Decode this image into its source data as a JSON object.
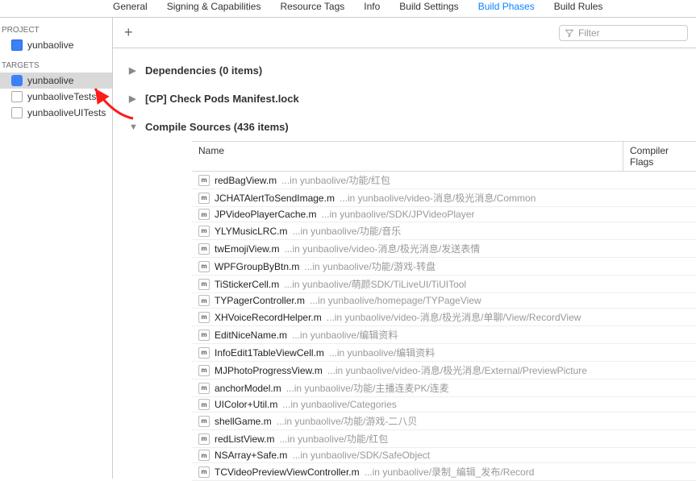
{
  "tabs": {
    "general": "General",
    "signing": "Signing & Capabilities",
    "resource": "Resource Tags",
    "info": "Info",
    "buildSettings": "Build Settings",
    "buildPhases": "Build Phases",
    "buildRules": "Build Rules"
  },
  "sidebar": {
    "projectLabel": "PROJECT",
    "project": "yunbaolive",
    "targetsLabel": "TARGETS",
    "targets": [
      "yunbaolive",
      "yunbaoliveTests",
      "yunbaoliveUITests"
    ]
  },
  "header": {
    "filterPlaceholder": "Filter"
  },
  "phases": {
    "dependencies": {
      "label": "Dependencies (0 items)"
    },
    "checkPods": {
      "label": "[CP] Check Pods Manifest.lock"
    },
    "compileSources": {
      "label": "Compile Sources (436 items)"
    }
  },
  "table": {
    "nameHeader": "Name",
    "flagsHeader": "Compiler Flags"
  },
  "files": [
    {
      "name": "redBagView.m",
      "path": "...in yunbaolive/功能/红包"
    },
    {
      "name": "JCHATAlertToSendImage.m",
      "path": "...in yunbaolive/video-消息/极光消息/Common"
    },
    {
      "name": "JPVideoPlayerCache.m",
      "path": "...in yunbaolive/SDK/JPVideoPlayer"
    },
    {
      "name": "YLYMusicLRC.m",
      "path": "...in yunbaolive/功能/音乐"
    },
    {
      "name": "twEmojiView.m",
      "path": "...in yunbaolive/video-消息/极光消息/发送表情"
    },
    {
      "name": "WPFGroupByBtn.m",
      "path": "...in yunbaolive/功能/游戏-转盘"
    },
    {
      "name": "TiStickerCell.m",
      "path": "...in yunbaolive/萌颜SDK/TiLiveUI/TiUITool"
    },
    {
      "name": "TYPagerController.m",
      "path": "...in yunbaolive/homepage/TYPageView"
    },
    {
      "name": "XHVoiceRecordHelper.m",
      "path": "...in yunbaolive/video-消息/极光消息/单聊/View/RecordView"
    },
    {
      "name": "EditNiceName.m",
      "path": "...in yunbaolive/编辑资料"
    },
    {
      "name": "InfoEdit1TableViewCell.m",
      "path": "...in yunbaolive/编辑资料"
    },
    {
      "name": "MJPhotoProgressView.m",
      "path": "...in yunbaolive/video-消息/极光消息/External/PreviewPicture"
    },
    {
      "name": "anchorModel.m",
      "path": "...in yunbaolive/功能/主播连麦PK/连麦"
    },
    {
      "name": "UIColor+Util.m",
      "path": "...in yunbaolive/Categories"
    },
    {
      "name": "shellGame.m",
      "path": "...in yunbaolive/功能/游戏-二八贝"
    },
    {
      "name": "redListView.m",
      "path": "...in yunbaolive/功能/红包"
    },
    {
      "name": "NSArray+Safe.m",
      "path": "...in yunbaolive/SDK/SafeObject"
    },
    {
      "name": "TCVideoPreviewViewController.m",
      "path": "...in yunbaolive/录制_编辑_发布/Record"
    }
  ]
}
